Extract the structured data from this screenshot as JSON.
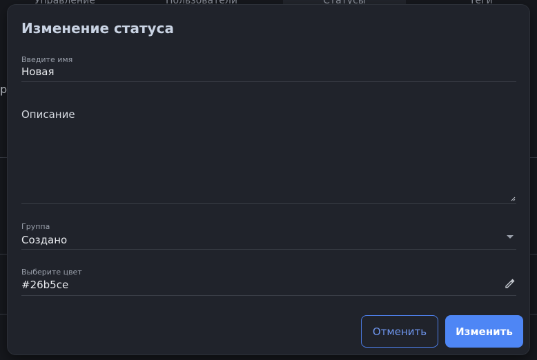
{
  "background": {
    "tabs": [
      "Управление",
      "Пользователи",
      "Статусы",
      "Теги"
    ],
    "left_letter": "р"
  },
  "modal": {
    "title": "Изменение статуса",
    "name_field": {
      "label": "Введите имя",
      "value": "Новая"
    },
    "description_field": {
      "label": "Описание",
      "value": ""
    },
    "group_field": {
      "label": "Группа",
      "value": "Создано"
    },
    "color_field": {
      "label": "Выберите цвет",
      "value": "#26b5ce"
    },
    "buttons": {
      "cancel": "Отменить",
      "submit": "Изменить"
    }
  },
  "colors": {
    "accent": "#4e86f5",
    "background": "#20232b"
  },
  "icons": {
    "dropdown": "chevron-down-icon",
    "color_picker": "eyedropper-icon",
    "resize": "resize-handle-icon"
  }
}
